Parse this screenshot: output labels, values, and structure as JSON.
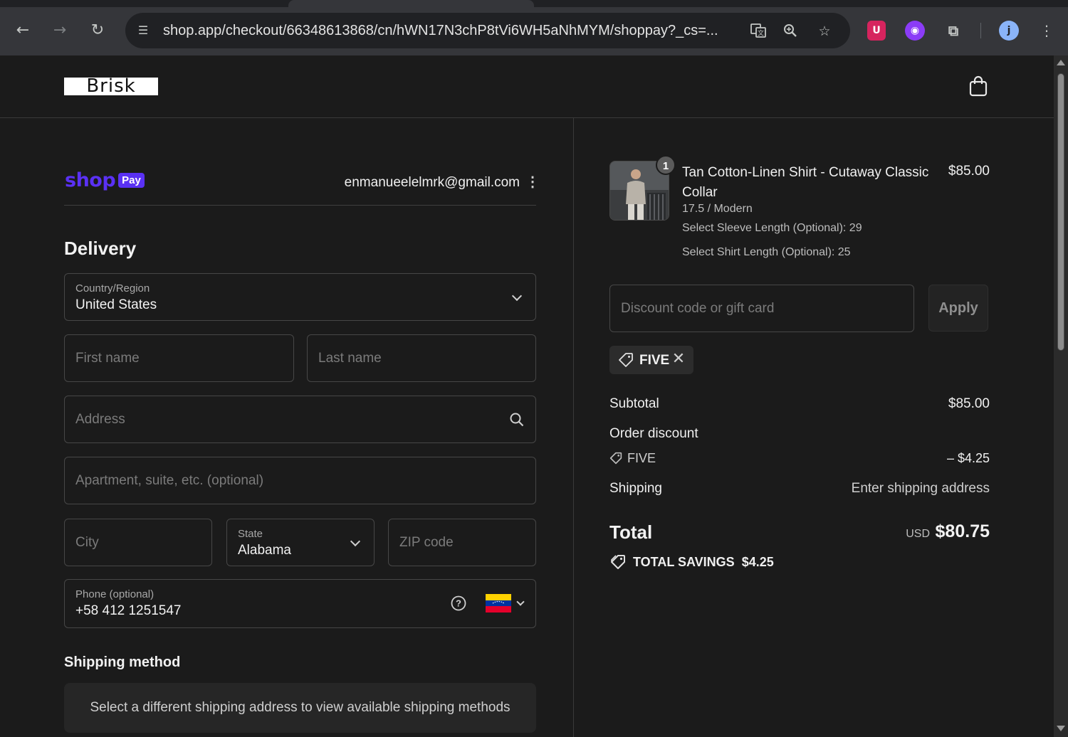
{
  "browser": {
    "url": "shop.app/checkout/66348613868/cn/hWN17N3chP8tVi6WH5aNhMYM/shoppay?_cs=...",
    "profile_initial": "j"
  },
  "header": {
    "logo_text": "Brisk"
  },
  "shop_pay": {
    "brand_word": "shop",
    "badge": "Pay",
    "email": "enmanueelelmrk@gmail.com"
  },
  "delivery": {
    "title": "Delivery",
    "country": {
      "label": "Country/Region",
      "value": "United States"
    },
    "first_name": {
      "placeholder": "First name"
    },
    "last_name": {
      "placeholder": "Last name"
    },
    "address": {
      "placeholder": "Address"
    },
    "apartment": {
      "placeholder": "Apartment, suite, etc. (optional)"
    },
    "city": {
      "placeholder": "City"
    },
    "state": {
      "label": "State",
      "value": "Alabama"
    },
    "zip": {
      "placeholder": "ZIP code"
    },
    "phone": {
      "label": "Phone (optional)",
      "value": "+58 412 1251547"
    }
  },
  "shipping_method": {
    "title": "Shipping method",
    "message": "Select a different shipping address to view available shipping methods"
  },
  "order": {
    "item": {
      "quantity": "1",
      "title": "Tan Cotton-Linen Shirt - Cutaway Classic Collar",
      "price": "$85.00",
      "variant": "17.5 / Modern",
      "sleeve": "Select Sleeve Length (Optional): 29",
      "shirt_length": "Select Shirt Length (Optional): 25"
    },
    "discount": {
      "placeholder": "Discount code or gift card",
      "apply_label": "Apply",
      "applied_code": "FIVE"
    },
    "summary": {
      "subtotal_label": "Subtotal",
      "subtotal_value": "$85.00",
      "order_discount_label": "Order discount",
      "discount_code": "FIVE",
      "discount_value": "– $4.25",
      "shipping_label": "Shipping",
      "shipping_value": "Enter shipping address",
      "total_label": "Total",
      "currency": "USD",
      "total_value": "$80.75",
      "savings_label": "TOTAL SAVINGS",
      "savings_value": "$4.25"
    }
  },
  "colors": {
    "shop_pay_purple": "#5a31f4",
    "page_background": "#1b1b1b"
  }
}
